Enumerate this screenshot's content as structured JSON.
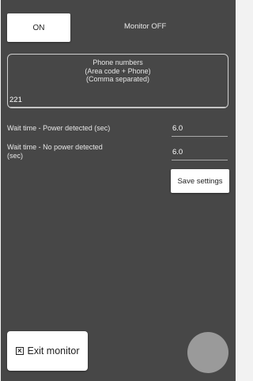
{
  "header": {
    "toggle_label": "ON",
    "monitor_status": "Monitor OFF"
  },
  "phone": {
    "label_line1": "Phone numbers",
    "label_line2": "(Area code + Phone)",
    "label_line3": "(Comma separated)",
    "value": "221"
  },
  "wait_power_detected": {
    "label": "Wait time - Power detected (sec)",
    "value": "6.0"
  },
  "wait_no_power": {
    "label_line1": "Wait time - No power detected",
    "label_line2": "(sec)",
    "value": "6.0"
  },
  "save_label": "Save settings",
  "exit": {
    "icon": "close-box-icon",
    "label": "Exit monitor"
  },
  "colors": {
    "background": "#474747",
    "button": "#ffffff",
    "fab": "#9a9a9a"
  }
}
